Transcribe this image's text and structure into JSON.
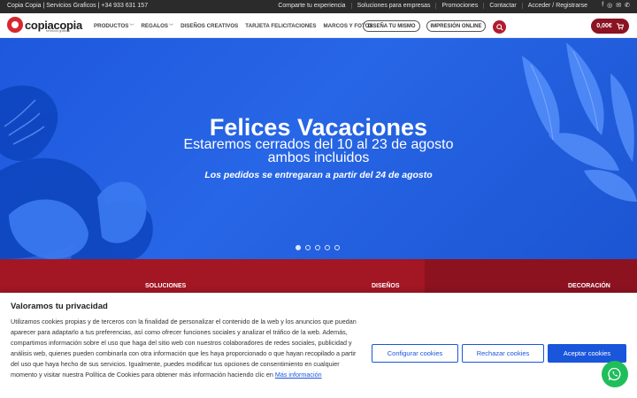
{
  "topbar": {
    "company": "Copia Copia | Servicios Graficos | +34 933 631 157",
    "links": [
      "Comparte tu experiencia",
      "Soluciones para empresas",
      "Promociones",
      "Contactar",
      "Acceder / Registrarse"
    ],
    "social_icons": [
      "facebook-icon",
      "instagram-icon",
      "mail-icon",
      "phone-icon"
    ]
  },
  "header": {
    "logo_text": "copiacopia",
    "logo_sub": "servicios gráficos",
    "nav": [
      {
        "label": "PRODUCTOS",
        "dropdown": true
      },
      {
        "label": "REGALOS",
        "dropdown": true
      },
      {
        "label": "DISEÑOS CREATIVOS",
        "dropdown": false
      },
      {
        "label": "TARJETA FELICITACIONES",
        "dropdown": false
      },
      {
        "label": "MARCOS Y FOTOS",
        "dropdown": false
      }
    ],
    "design_btn": "DISEÑA TU MISMO",
    "print_btn": "IMPRESIÓN ONLINE",
    "cart_total": "0,00€",
    "colors": {
      "brand": "#b01c2e",
      "cart": "#8b1322"
    }
  },
  "hero": {
    "title": "Felices Vacaciones",
    "subtitle": "Estaremos cerrados del 10 al 23 de agosto ambos incluidos",
    "note": "Los pedidos se entregaran a partir del 24 de agosto",
    "slide_count": 5,
    "active_slide": 1,
    "colors": {
      "background": "#2766e6"
    }
  },
  "categories": [
    {
      "label": "SOLUCIONES",
      "color": "#a31624"
    },
    {
      "label": "DISEÑOS",
      "color": "#a31624"
    },
    {
      "label": "DECORACIÓN",
      "color": "#8d1220"
    }
  ],
  "cookie": {
    "title": "Valoramos tu privacidad",
    "text": "Utilizamos cookies propias y de terceros con la finalidad de personalizar el contenido de la web y los anuncios que puedan aparecer para adaptarlo a tus preferencias, así como ofrecer funciones sociales y analizar el tráfico de la web. Además, compartimos información sobre el uso que haga del sitio web con nuestros colaboradores de redes sociales, publicidad y análisis web, quienes pueden combinarla con otra información que les haya proporcionado o que hayan recopilado a partir del uso que haya hecho de sus servicios. Igualmente, puedes modificar tus opciones de consentimiento en cualquier momento y visitar nuestra Política de Cookies para obtener más información haciendo clic en",
    "link": "Más información",
    "configure_btn": "Configurar cookies",
    "reject_btn": "Rechazar cookies",
    "accept_btn": "Aceptar cookies",
    "accent": "#1a56db"
  },
  "whatsapp_icon": "whatsapp-icon"
}
